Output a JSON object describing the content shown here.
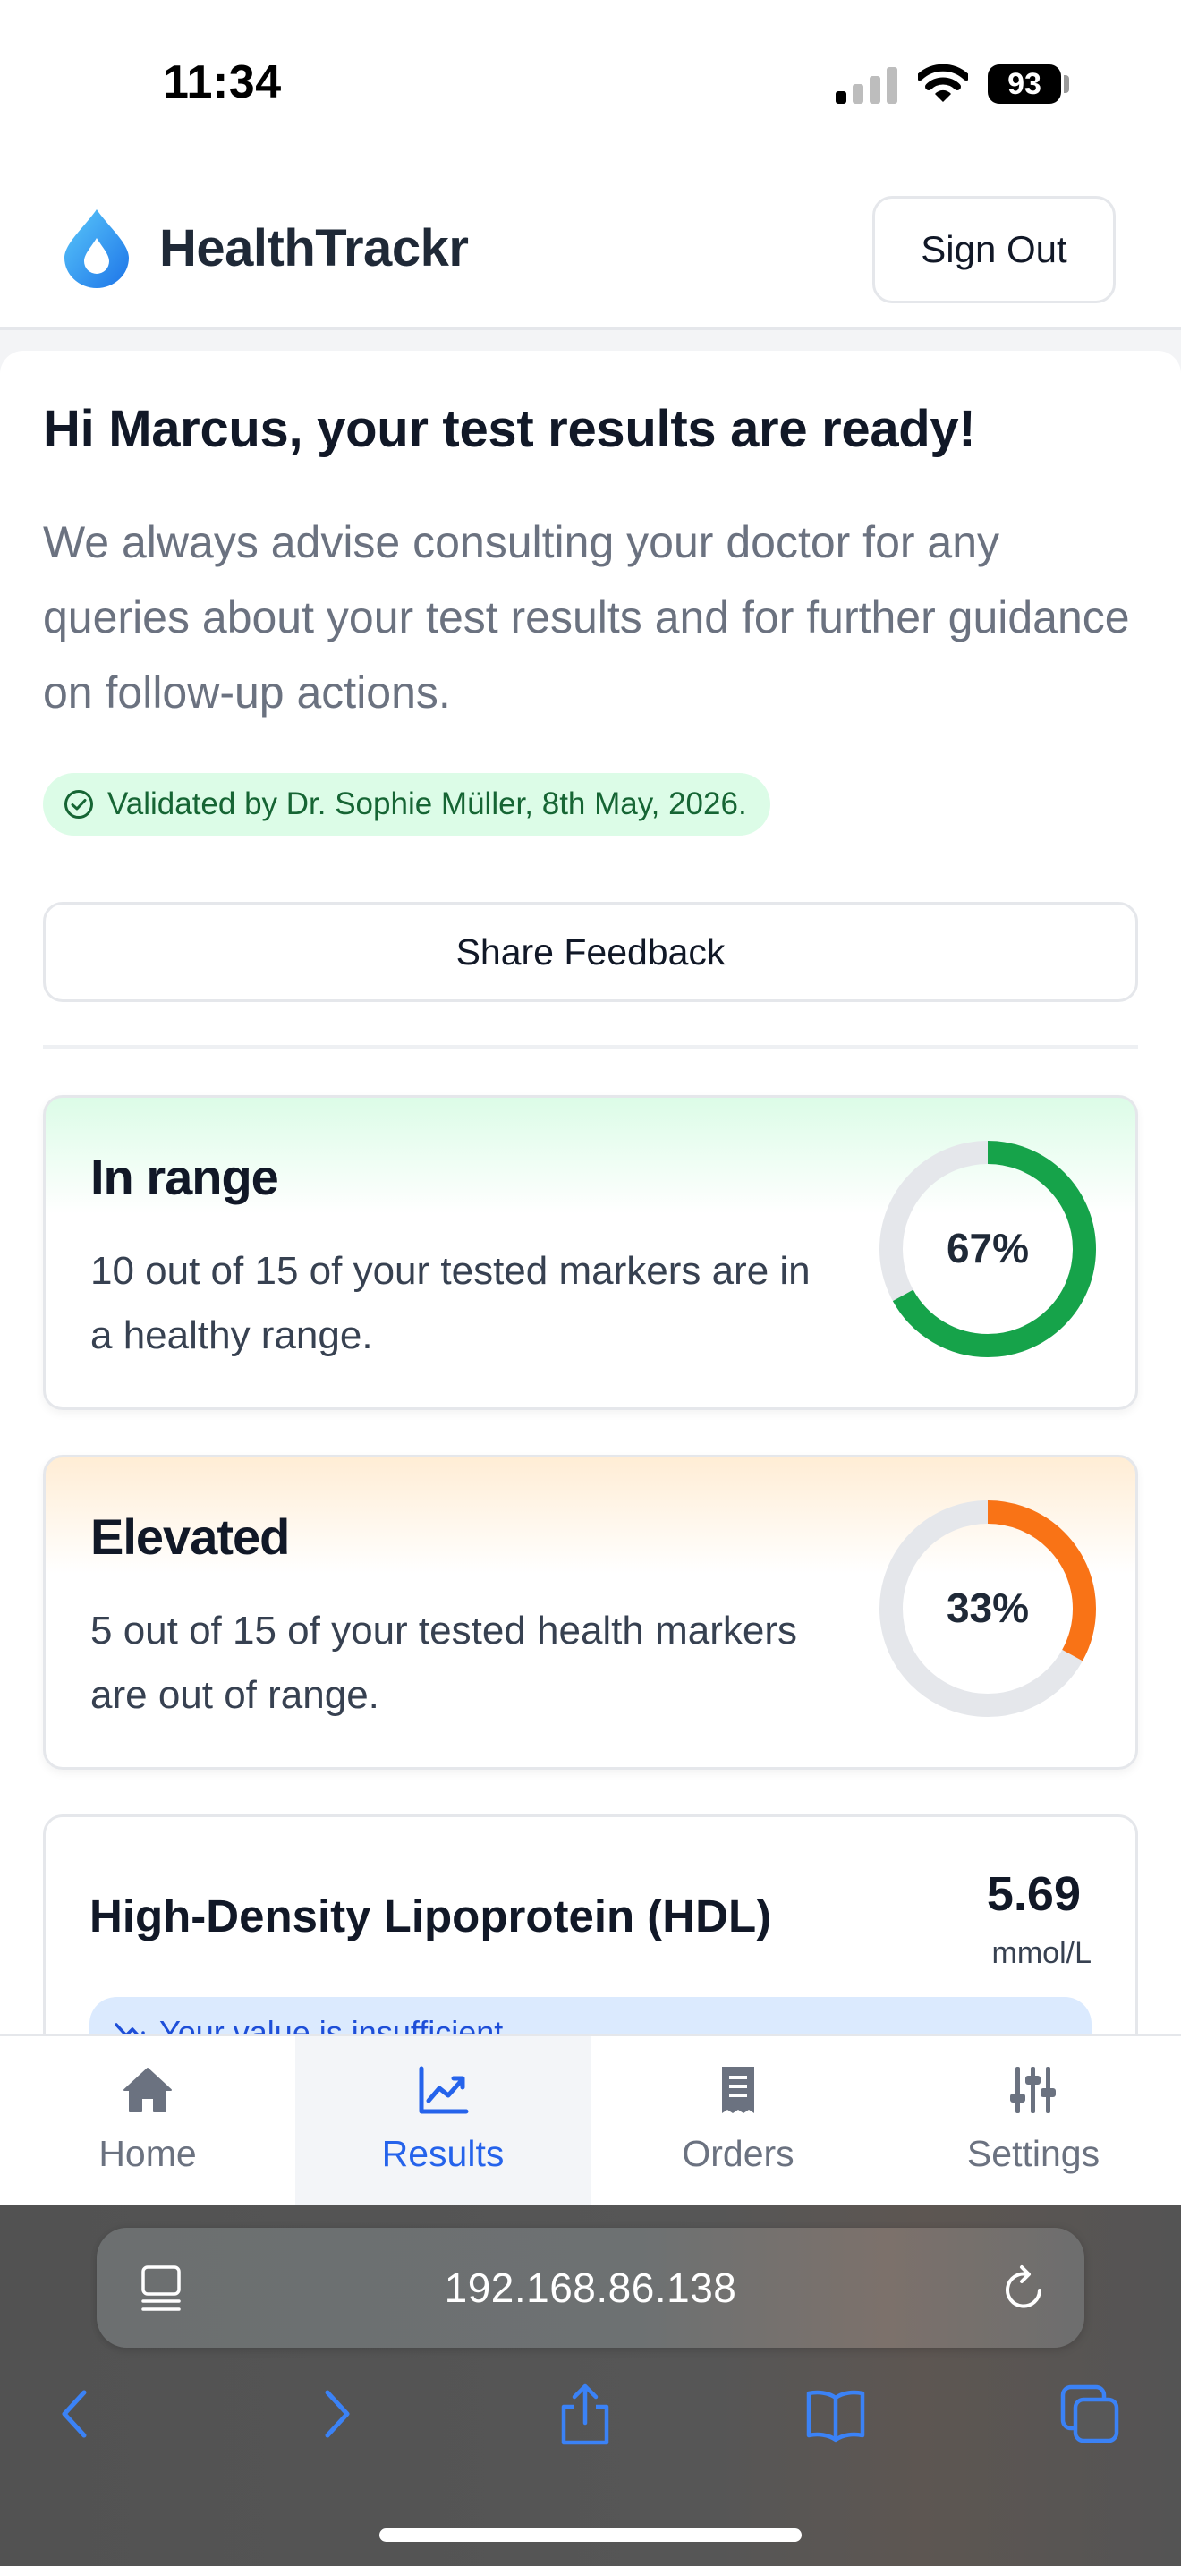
{
  "status_bar": {
    "time": "11:34",
    "battery": "93"
  },
  "header": {
    "brand": "HealthTrackr",
    "sign_out": "Sign Out"
  },
  "intro": {
    "greeting": "Hi Marcus, your test results are ready!",
    "advice": "We always advise consulting your doctor for any queries about your test results and for further guidance on follow-up actions.",
    "validated": "Validated by Dr. Sophie Müller, 8th May, 2026.",
    "share_feedback": "Share Feedback"
  },
  "summary_cards": [
    {
      "title": "In range",
      "description": "10 out of 15 of your tested markers are in a healthy range.",
      "percent_label": "67%",
      "fraction": 0.67,
      "color": "#16a34a"
    },
    {
      "title": "Elevated",
      "description": "5 out of 15 of your tested health markers are out of range.",
      "percent_label": "33%",
      "fraction": 0.33,
      "color": "#f97316"
    }
  ],
  "marker": {
    "name": "High-Density Lipoprotein (HDL)",
    "value": "5.69",
    "unit": "mmol/L",
    "status": "Your value is insufficient"
  },
  "bottom_nav": [
    {
      "label": "Home",
      "icon": "home-icon",
      "active": false
    },
    {
      "label": "Results",
      "icon": "chart-icon",
      "active": true
    },
    {
      "label": "Orders",
      "icon": "receipt-icon",
      "active": false
    },
    {
      "label": "Settings",
      "icon": "sliders-icon",
      "active": false
    }
  ],
  "browser": {
    "url": "192.168.86.138"
  },
  "colors": {
    "accent": "#2563eb",
    "in_range": "#16a34a",
    "elevated": "#f97316",
    "track": "#e5e7eb"
  }
}
